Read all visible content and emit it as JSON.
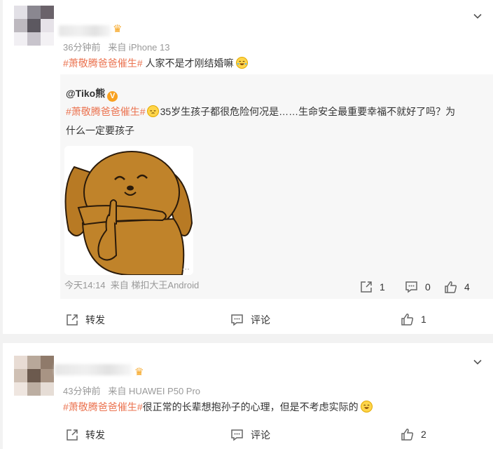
{
  "comments": [
    {
      "time": "36分钟前",
      "source": "来自 iPhone 13",
      "hashtag": "#萧敬腾爸爸催生#",
      "text": " 人家不是才刚结婚嘛",
      "emoji": "laughing-crying-emoji",
      "actions": {
        "forward_label": "转发",
        "comment_label": "评论",
        "like_count": "1"
      },
      "repost": {
        "user": "@Tiko熊",
        "badge": "V",
        "hashtag": "#萧敬腾爸爸催生#",
        "text_line1": "35岁生孩子都很危险何况是……生命安全最重要幸福不就好了吗？为",
        "text_line2": "什么一定要孩子",
        "image": "brown-bear-sticker",
        "time": "今天14:14",
        "source": "来自 梯扣大王Android",
        "forward_count": "1",
        "comment_count": "0",
        "like_count": "4"
      }
    },
    {
      "time": "43分钟前",
      "source": "来自 HUAWEI P50 Pro",
      "hashtag": "#萧敬腾爸爸催生#",
      "text": "很正常的长辈想抱孙子的心理，但是不考虑实际的",
      "emoji": "laughing-emoji",
      "actions": {
        "forward_label": "转发",
        "comment_label": "评论",
        "like_count": "2"
      }
    }
  ],
  "colors": {
    "tag": "#eb7350",
    "meta": "#999999",
    "repost_bg": "#f7f7f7",
    "page_bg": "#f2f2f2"
  }
}
